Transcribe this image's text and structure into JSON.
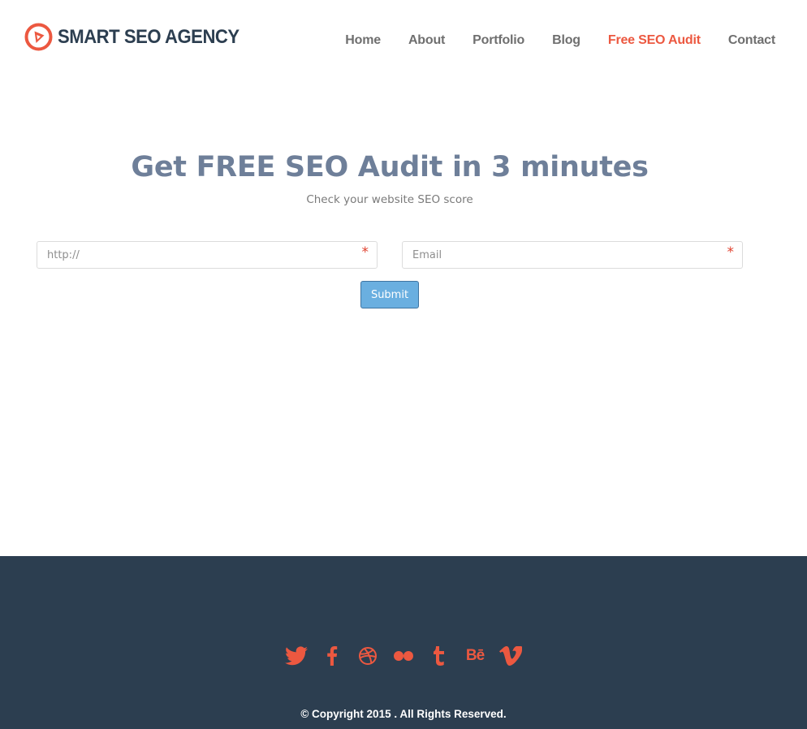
{
  "brand": {
    "name": "SMART SEO AGENCY",
    "accent_color": "#ec5840",
    "logo_icon": "compass-play-logo-icon"
  },
  "nav": {
    "items": [
      {
        "label": "Home",
        "active": false
      },
      {
        "label": "About",
        "active": false
      },
      {
        "label": "Portfolio",
        "active": false
      },
      {
        "label": "Blog",
        "active": false
      },
      {
        "label": "Free SEO Audit",
        "active": true
      },
      {
        "label": "Contact",
        "active": false
      }
    ]
  },
  "hero": {
    "title": "Get FREE SEO Audit in 3 minutes",
    "subtitle": "Check your website SEO score"
  },
  "form": {
    "url_placeholder": "http://",
    "url_value": "",
    "email_placeholder": "Email",
    "email_value": "",
    "required_marker": "*",
    "submit_label": "Submit"
  },
  "footer": {
    "background_color": "#2c3e50",
    "social_icons": [
      "twitter-icon",
      "facebook-icon",
      "dribbble-icon",
      "flickr-icon",
      "tumblr-icon",
      "behance-icon",
      "vimeo-icon"
    ],
    "behance_glyph": "Bē",
    "copyright": "© Copyright 2015 . All Rights Reserved."
  }
}
